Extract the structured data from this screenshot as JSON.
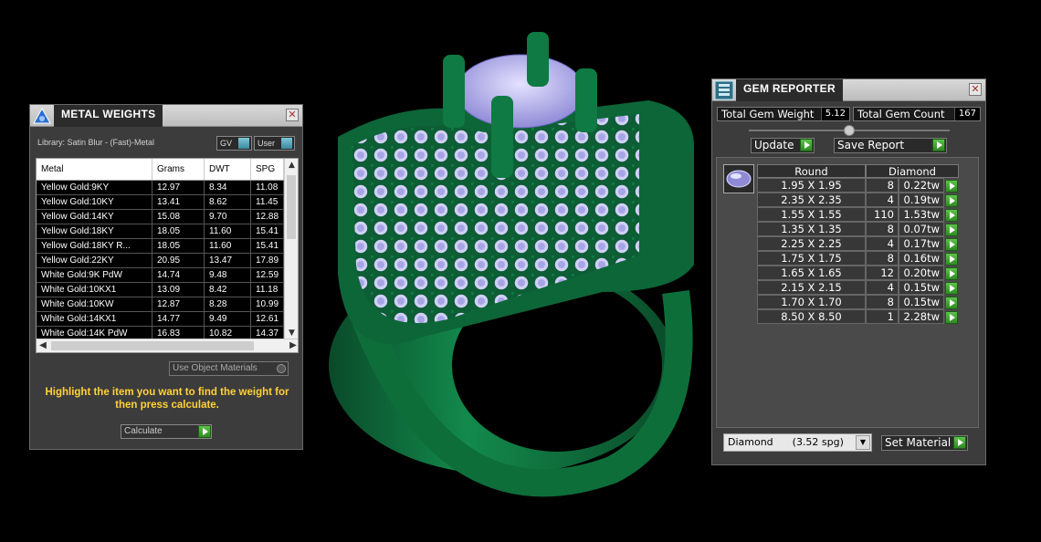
{
  "metal_panel": {
    "title": "METAL WEIGHTS",
    "library_label": "Library: Satin Blur - (Fast)-Metal",
    "gv_label": "GV",
    "user_label": "User",
    "columns": [
      "Metal",
      "Grams",
      "DWT",
      "SPG"
    ],
    "rows": [
      {
        "metal": "Yellow Gold:9KY",
        "grams": "12.97",
        "dwt": "8.34",
        "spg": "11.08"
      },
      {
        "metal": "Yellow Gold:10KY",
        "grams": "13.41",
        "dwt": "8.62",
        "spg": "11.45"
      },
      {
        "metal": "Yellow Gold:14KY",
        "grams": "15.08",
        "dwt": "9.70",
        "spg": "12.88"
      },
      {
        "metal": "Yellow Gold:18KY",
        "grams": "18.05",
        "dwt": "11.60",
        "spg": "15.41"
      },
      {
        "metal": "Yellow Gold:18KY R...",
        "grams": "18.05",
        "dwt": "11.60",
        "spg": "15.41"
      },
      {
        "metal": "Yellow Gold:22KY",
        "grams": "20.95",
        "dwt": "13.47",
        "spg": "17.89"
      },
      {
        "metal": "White Gold:9K PdW",
        "grams": "14.74",
        "dwt": "9.48",
        "spg": "12.59"
      },
      {
        "metal": "White Gold:10KX1",
        "grams": "13.09",
        "dwt": "8.42",
        "spg": "11.18"
      },
      {
        "metal": "White Gold:10KW",
        "grams": "12.87",
        "dwt": "8.28",
        "spg": "10.99"
      },
      {
        "metal": "White Gold:14KX1",
        "grams": "14.77",
        "dwt": "9.49",
        "spg": "12.61"
      },
      {
        "metal": "White Gold:14K PdW",
        "grams": "16.83",
        "dwt": "10.82",
        "spg": "14.37"
      }
    ],
    "use_object_materials": "Use Object Materials",
    "hint": "Highlight the item you want to find the weight for then press calculate.",
    "calculate_label": "Calculate"
  },
  "gem_panel": {
    "title": "GEM REPORTER",
    "total_weight_label": "Total Gem Weight",
    "total_weight_value": "5.12",
    "total_count_label": "Total Gem Count",
    "total_count_value": "167",
    "update_label": "Update",
    "save_report_label": "Save Report",
    "shape_header": "Round",
    "material_header": "Diamond",
    "gems": [
      {
        "size": "1.95 X 1.95",
        "count": "8",
        "tw": "0.22tw"
      },
      {
        "size": "2.35 X 2.35",
        "count": "4",
        "tw": "0.19tw"
      },
      {
        "size": "1.55 X 1.55",
        "count": "110",
        "tw": "1.53tw"
      },
      {
        "size": "1.35 X 1.35",
        "count": "8",
        "tw": "0.07tw"
      },
      {
        "size": "2.25 X 2.25",
        "count": "4",
        "tw": "0.17tw"
      },
      {
        "size": "1.75 X 1.75",
        "count": "8",
        "tw": "0.16tw"
      },
      {
        "size": "1.65 X 1.65",
        "count": "12",
        "tw": "0.20tw"
      },
      {
        "size": "2.15 X 2.15",
        "count": "4",
        "tw": "0.15tw"
      },
      {
        "size": "1.70 X 1.70",
        "count": "8",
        "tw": "0.15tw"
      },
      {
        "size": "8.50 X 8.50",
        "count": "1",
        "tw": "2.28tw"
      }
    ],
    "material_select": "Diamond      (3.52 spg)",
    "set_material_label": "Set Material"
  },
  "colors": {
    "ring_green": "#0f6b3c",
    "gem_lavender": "#c9c6f2",
    "hint_yellow": "#ffd23a",
    "play_green": "#3fa32f"
  }
}
